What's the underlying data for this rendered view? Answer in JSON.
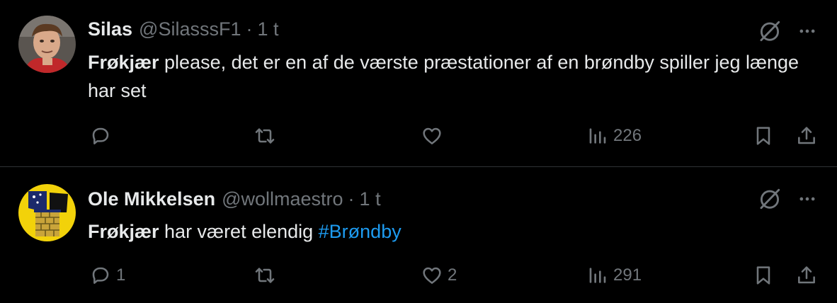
{
  "tweets": [
    {
      "name": "Silas",
      "handle": "@SilasssF1",
      "separator": "·",
      "time": "1 t",
      "text_bold": "Frøkjær",
      "text_rest": " please, det er en af de værste præstationer af en brøndby spiller jeg længe har set",
      "hashtag": "",
      "replies": "",
      "retweets": "",
      "likes": "",
      "views": "226",
      "avatar_icon": "user-photo-avatar"
    },
    {
      "name": "Ole Mikkelsen",
      "handle": "@wollmaestro",
      "separator": "·",
      "time": "1 t",
      "text_bold": "Frøkjær",
      "text_rest": " har været elendig ",
      "hashtag": "#Brøndby",
      "replies": "1",
      "retweets": "",
      "likes": "2",
      "views": "291",
      "avatar_icon": "brondby-crest-avatar"
    }
  ],
  "icons": {
    "grok": "grok-icon",
    "more": "more-icon",
    "reply": "reply-icon",
    "retweet": "retweet-icon",
    "like": "heart-icon",
    "views": "views-icon",
    "bookmark": "bookmark-icon",
    "share": "share-icon"
  },
  "colors": {
    "background": "#000000",
    "text": "#e7e9ea",
    "secondary": "#71767b",
    "link": "#1d9bf0",
    "divider": "#2f3336"
  }
}
